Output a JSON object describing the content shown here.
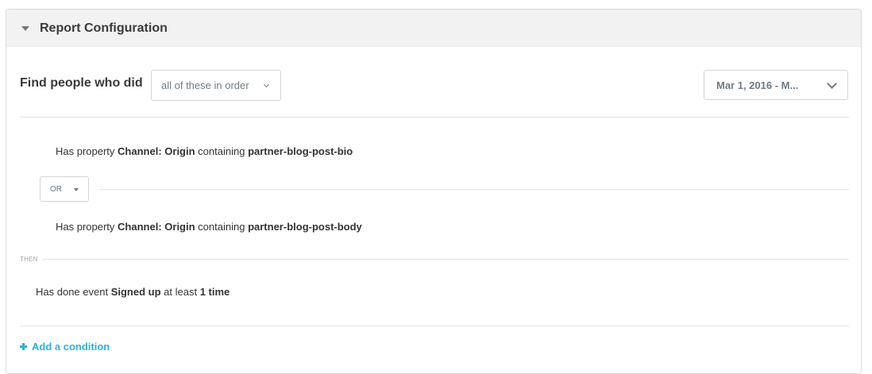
{
  "header": {
    "title": "Report Configuration"
  },
  "query": {
    "find_label": "Find people who did",
    "mode_value": "all of these in order",
    "date_range_value": "Mar 1, 2016 - M..."
  },
  "conditions": {
    "first": {
      "prefix": "Has property",
      "property": "Channel: Origin",
      "operator": "containing",
      "value": "partner-blog-post-bio"
    },
    "joiner": "OR",
    "second": {
      "prefix": "Has property",
      "property": "Channel: Origin",
      "operator": "containing",
      "value": "partner-blog-post-body"
    },
    "then_label": "THEN",
    "event": {
      "prefix": "Has done event",
      "event_name": "Signed up",
      "operator": "at least",
      "count": "1 time"
    }
  },
  "footer": {
    "add_condition_label": "Add a condition"
  },
  "colors": {
    "accent": "#2ab4d6",
    "header_bg": "#f2f2f2"
  },
  "icons": {
    "collapse": "caret-down-icon",
    "mode_caret": "chevron-down-icon",
    "date_chevron": "chevron-down-icon",
    "or_caret": "caret-down-icon",
    "add": "plus-icon"
  }
}
